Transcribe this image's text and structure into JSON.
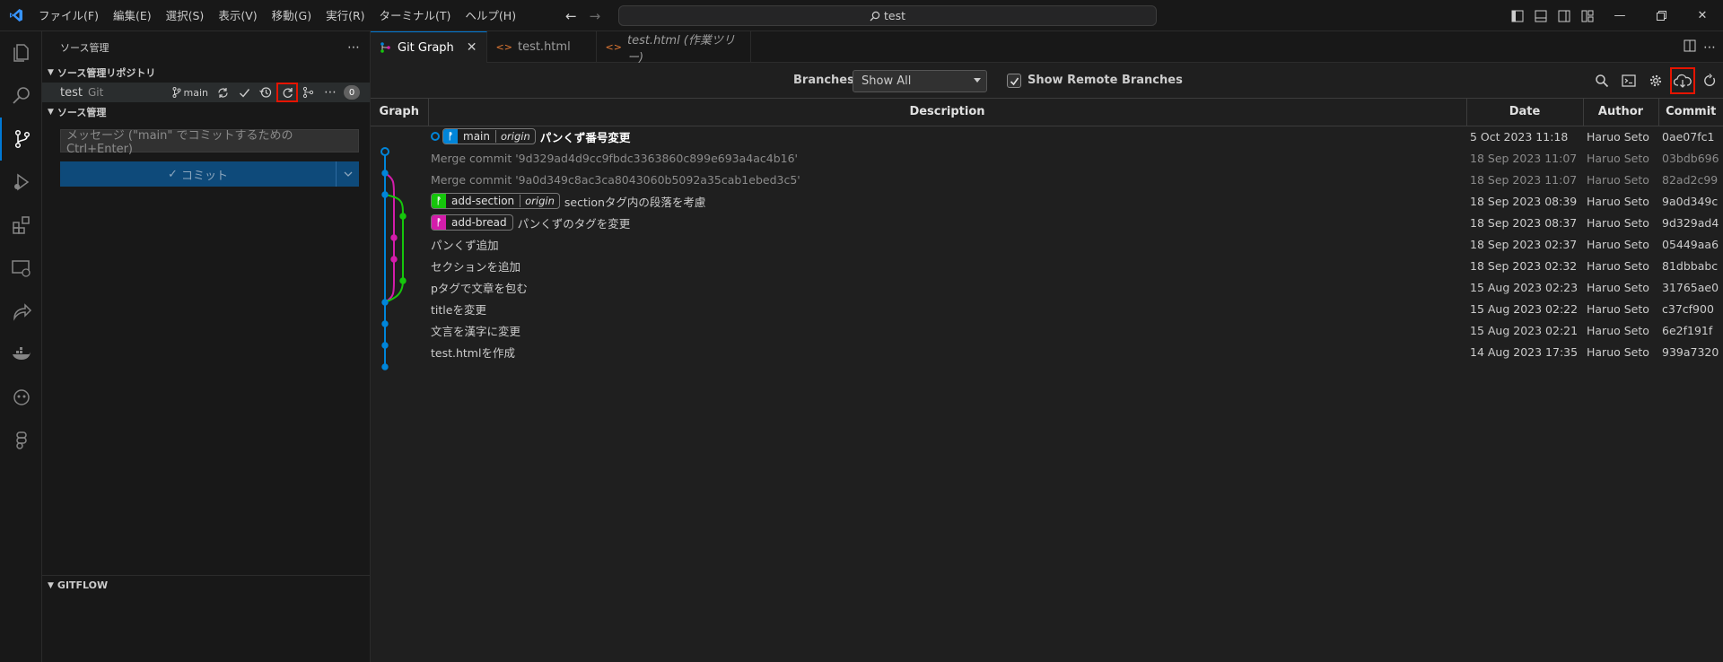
{
  "menu": [
    "ファイル(F)",
    "編集(E)",
    "選択(S)",
    "表示(V)",
    "移動(G)",
    "実行(R)",
    "ターミナル(T)",
    "ヘルプ(H)"
  ],
  "search": {
    "text": "test"
  },
  "sidebar": {
    "title": "ソース管理",
    "repos_section": "ソース管理リポジトリ",
    "repo": {
      "name": "test",
      "type": "Git",
      "branch": "main",
      "changes": "0"
    },
    "scm_section": "ソース管理",
    "commit_placeholder": "メッセージ (\"main\" でコミットするためのCtrl+Enter)",
    "commit_button": "コミット",
    "gitflow": "GITFLOW"
  },
  "tabs": [
    {
      "label": "Git Graph",
      "italic": false
    },
    {
      "label": "test.html",
      "italic": false
    },
    {
      "label": "test.html (作業ツリー)",
      "italic": true
    }
  ],
  "controls": {
    "branches_label": "Branches:",
    "branches_value": "Show All",
    "remote_label": "Show Remote Branches",
    "remote_checked": true
  },
  "columns": {
    "graph": "Graph",
    "description": "Description",
    "date": "Date",
    "author": "Author",
    "commit": "Commit"
  },
  "commits": [
    {
      "refs": [
        {
          "name": "main",
          "origin": "origin",
          "color": "#0085d9"
        }
      ],
      "head": true,
      "message": "パンくず番号変更",
      "bold": true,
      "merge": false,
      "date": "5 Oct 2023 11:18",
      "author": "Haruo Seto",
      "hash": "0ae07fc1"
    },
    {
      "refs": [],
      "head": false,
      "message": "Merge commit '9d329ad4d9cc9fbdc3363860c899e693a4ac4b16'",
      "bold": false,
      "merge": true,
      "date": "18 Sep 2023 11:07",
      "author": "Haruo Seto",
      "hash": "03bdb696"
    },
    {
      "refs": [],
      "head": false,
      "message": "Merge commit '9a0d349c8ac3ca8043060b5092a35cab1ebed3c5'",
      "bold": false,
      "merge": true,
      "date": "18 Sep 2023 11:07",
      "author": "Haruo Seto",
      "hash": "82ad2c99"
    },
    {
      "refs": [
        {
          "name": "add-section",
          "origin": "origin",
          "color": "#16c60c"
        }
      ],
      "head": false,
      "message": "sectionタグ内の段落を考慮",
      "bold": false,
      "merge": false,
      "date": "18 Sep 2023 08:39",
      "author": "Haruo Seto",
      "hash": "9a0d349c"
    },
    {
      "refs": [
        {
          "name": "add-bread",
          "origin": "",
          "color": "#d41dab"
        }
      ],
      "head": false,
      "message": "パンくずのタグを変更",
      "bold": false,
      "merge": false,
      "date": "18 Sep 2023 08:37",
      "author": "Haruo Seto",
      "hash": "9d329ad4"
    },
    {
      "refs": [],
      "head": false,
      "message": "パンくず追加",
      "bold": false,
      "merge": false,
      "date": "18 Sep 2023 02:37",
      "author": "Haruo Seto",
      "hash": "05449aa6"
    },
    {
      "refs": [],
      "head": false,
      "message": "セクションを追加",
      "bold": false,
      "merge": false,
      "date": "18 Sep 2023 02:32",
      "author": "Haruo Seto",
      "hash": "81dbbabc"
    },
    {
      "refs": [],
      "head": false,
      "message": "pタグで文章を包む",
      "bold": false,
      "merge": false,
      "date": "15 Aug 2023 02:23",
      "author": "Haruo Seto",
      "hash": "31765ae0"
    },
    {
      "refs": [],
      "head": false,
      "message": "titleを変更",
      "bold": false,
      "merge": false,
      "date": "15 Aug 2023 02:22",
      "author": "Haruo Seto",
      "hash": "c37cf900"
    },
    {
      "refs": [],
      "head": false,
      "message": "文言を漢字に変更",
      "bold": false,
      "merge": false,
      "date": "15 Aug 2023 02:21",
      "author": "Haruo Seto",
      "hash": "6e2f191f"
    },
    {
      "refs": [],
      "head": false,
      "message": "test.htmlを作成",
      "bold": false,
      "merge": false,
      "date": "14 Aug 2023 17:35",
      "author": "Haruo Seto",
      "hash": "939a7320"
    }
  ],
  "colors": {
    "accent": "#0078d4",
    "main": "#0085d9",
    "section": "#16c60c",
    "bread": "#d41dab",
    "highlight": "#e51400"
  }
}
